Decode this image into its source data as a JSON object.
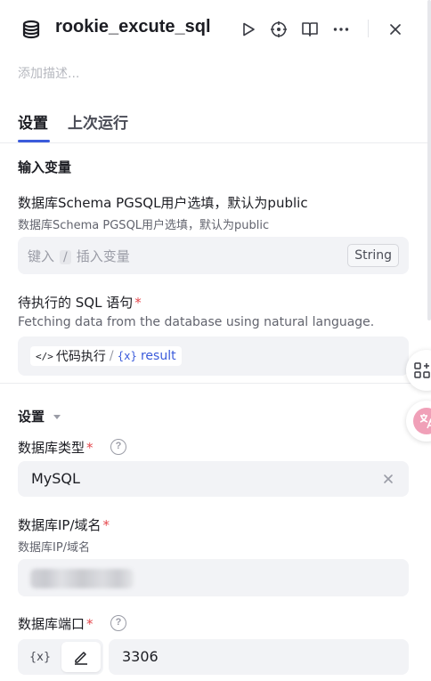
{
  "header": {
    "title": "rookie_excute_sql",
    "icons": [
      "database-icon",
      "run-icon",
      "locate-icon",
      "docs-icon",
      "more-icon",
      "close-icon"
    ]
  },
  "description_placeholder": "添加描述...",
  "tabs": [
    {
      "label": "设置",
      "active": true
    },
    {
      "label": "上次运行",
      "active": false
    }
  ],
  "inputs_section": {
    "title": "输入变量",
    "schema_field": {
      "label": "数据库Schema PGSQL用户选填，默认为public",
      "description": "数据库Schema PGSQL用户选填，默认为public",
      "placeholder_prefix": "键入",
      "placeholder_key": "/",
      "placeholder_suffix": "插入变量",
      "type_badge": "String"
    },
    "sql_field": {
      "label": "待执行的 SQL 语句",
      "required_mark": "*",
      "description": "Fetching data from the database using natural language.",
      "ref_code_icon": "</>",
      "ref_node": "代码执行",
      "ref_separator": "/",
      "ref_var_icon": "{x}",
      "ref_var": "result"
    }
  },
  "settings_section": {
    "title": "设置",
    "db_type": {
      "label": "数据库类型",
      "required_mark": "*",
      "help": "?",
      "value": "MySQL"
    },
    "db_host": {
      "label": "数据库IP/域名",
      "required_mark": "*",
      "description": "数据库IP/域名"
    },
    "db_port": {
      "label": "数据库端口",
      "required_mark": "*",
      "help": "?",
      "toggle_var": "{x}",
      "value": "3306"
    }
  },
  "colors": {
    "accent": "#3b5bdb",
    "required": "#e5484d",
    "field_bg": "#f2f3f6"
  }
}
